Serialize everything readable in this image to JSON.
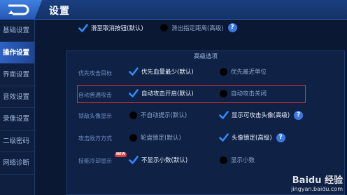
{
  "header": {
    "title": "设置"
  },
  "sidebar": {
    "items": [
      {
        "label": "基础设置",
        "active": false
      },
      {
        "label": "操作设置",
        "active": true
      },
      {
        "label": "界面设置",
        "active": false
      },
      {
        "label": "音效设置",
        "active": false
      },
      {
        "label": "录像设置",
        "active": false
      },
      {
        "label": "二级密码",
        "active": false
      },
      {
        "label": "网络诊断",
        "active": false
      }
    ]
  },
  "main": {
    "top_options": [
      {
        "label": "滑至取消按钮(默认)",
        "checked": true
      },
      {
        "label": "滑出指定距离(高级)",
        "checked": false
      }
    ],
    "advanced": {
      "title": "高级选项",
      "rows": [
        {
          "label": "优先攻击目标",
          "opt1": "优先血量最少(默认)",
          "opt1_checked": true,
          "opt2": "优先最近单位",
          "opt2_checked": false
        },
        {
          "label": "自动普通攻击",
          "opt1": "自动攻击开启(默认)",
          "opt1_checked": true,
          "opt2": "自动攻击关闭",
          "opt2_checked": false
        },
        {
          "label": "锁敌头像显示",
          "opt1": "不自动提示(默认)",
          "opt1_checked": false,
          "opt2": "显示可攻击头像(高级)",
          "opt2_checked": true
        },
        {
          "label": "攻击敌方方式",
          "opt1": "轮盘锁定(默认)",
          "opt1_checked": false,
          "opt2": "头像锁定(高级)",
          "opt2_checked": true
        },
        {
          "label": "技能冷却显示",
          "opt1": "不显示小数(默认)",
          "opt1_checked": true,
          "opt2": "显示小数",
          "opt2_checked": false
        }
      ],
      "new_badge": "NEW"
    }
  },
  "watermark": {
    "brand": "Baidu 经验",
    "url": "jingyan.baidu.com"
  },
  "colors": {
    "accent": "#3a7ae0",
    "check": "#2f8cff",
    "highlight": "#e03030"
  }
}
